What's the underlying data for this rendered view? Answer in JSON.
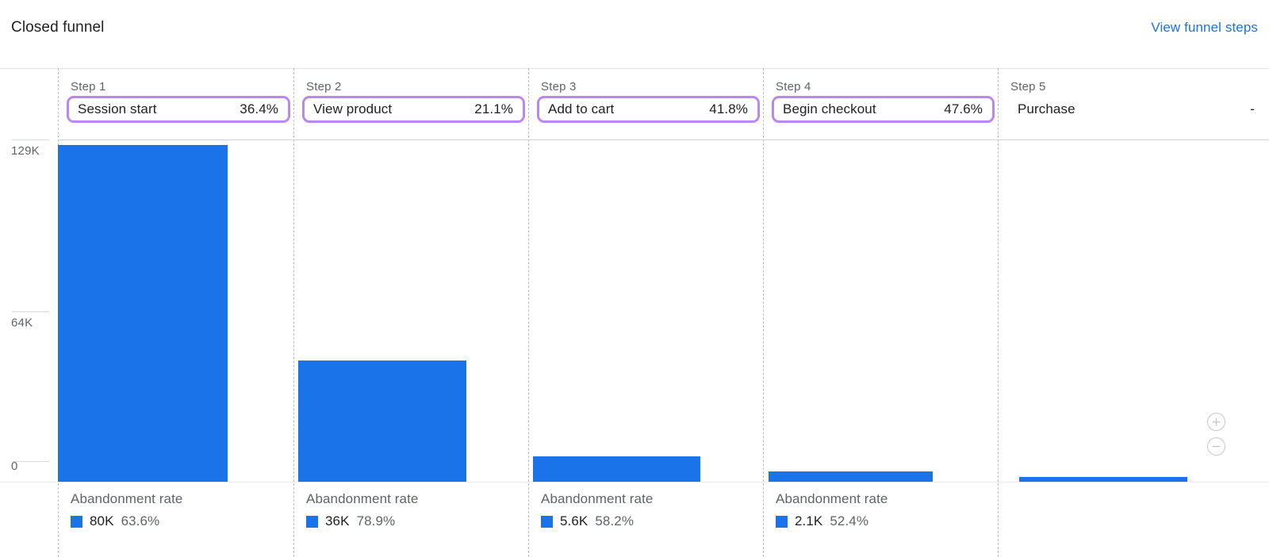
{
  "header": {
    "title": "Closed funnel",
    "link_label": "View funnel steps",
    "link_color": "#1a73e8"
  },
  "colors": {
    "bar": "#1a73e8",
    "highlight_border": "#bb86f0",
    "muted_text": "#5f6368",
    "primary_text": "#202124",
    "divider": "#bdbdbd"
  },
  "chart_data": {
    "type": "bar",
    "title": "Closed funnel",
    "xlabel": "",
    "ylabel": "",
    "ylim": [
      0,
      129000
    ],
    "grid": false,
    "legend_position": "below-each-column",
    "y_ticks": [
      "0",
      "64K",
      "129K"
    ],
    "y_tick_values": [
      0,
      64000,
      129000
    ],
    "categories": [
      "Session start",
      "View product",
      "Add to cart",
      "Begin checkout",
      "Purchase"
    ],
    "values": [
      126000,
      46000,
      9600,
      3900,
      1800
    ],
    "steps": [
      {
        "index_label": "Step 1",
        "name": "Session start",
        "completion_rate": "36.4%",
        "highlighted": true,
        "abandonment_label": "Abandonment rate",
        "abandonment_value": "80K",
        "abandonment_pct": "63.6%"
      },
      {
        "index_label": "Step 2",
        "name": "View product",
        "completion_rate": "21.1%",
        "highlighted": true,
        "abandonment_label": "Abandonment rate",
        "abandonment_value": "36K",
        "abandonment_pct": "78.9%"
      },
      {
        "index_label": "Step 3",
        "name": "Add to cart",
        "completion_rate": "41.8%",
        "highlighted": true,
        "abandonment_label": "Abandonment rate",
        "abandonment_value": "5.6K",
        "abandonment_pct": "58.2%"
      },
      {
        "index_label": "Step 4",
        "name": "Begin checkout",
        "completion_rate": "47.6%",
        "highlighted": true,
        "abandonment_label": "Abandonment rate",
        "abandonment_value": "2.1K",
        "abandonment_pct": "52.4%"
      },
      {
        "index_label": "Step 5",
        "name": "Purchase",
        "completion_rate": "-",
        "highlighted": false,
        "abandonment_label": "",
        "abandonment_value": "",
        "abandonment_pct": ""
      }
    ]
  },
  "controls": {
    "zoom_in": "zoom-in",
    "zoom_out": "zoom-out"
  }
}
